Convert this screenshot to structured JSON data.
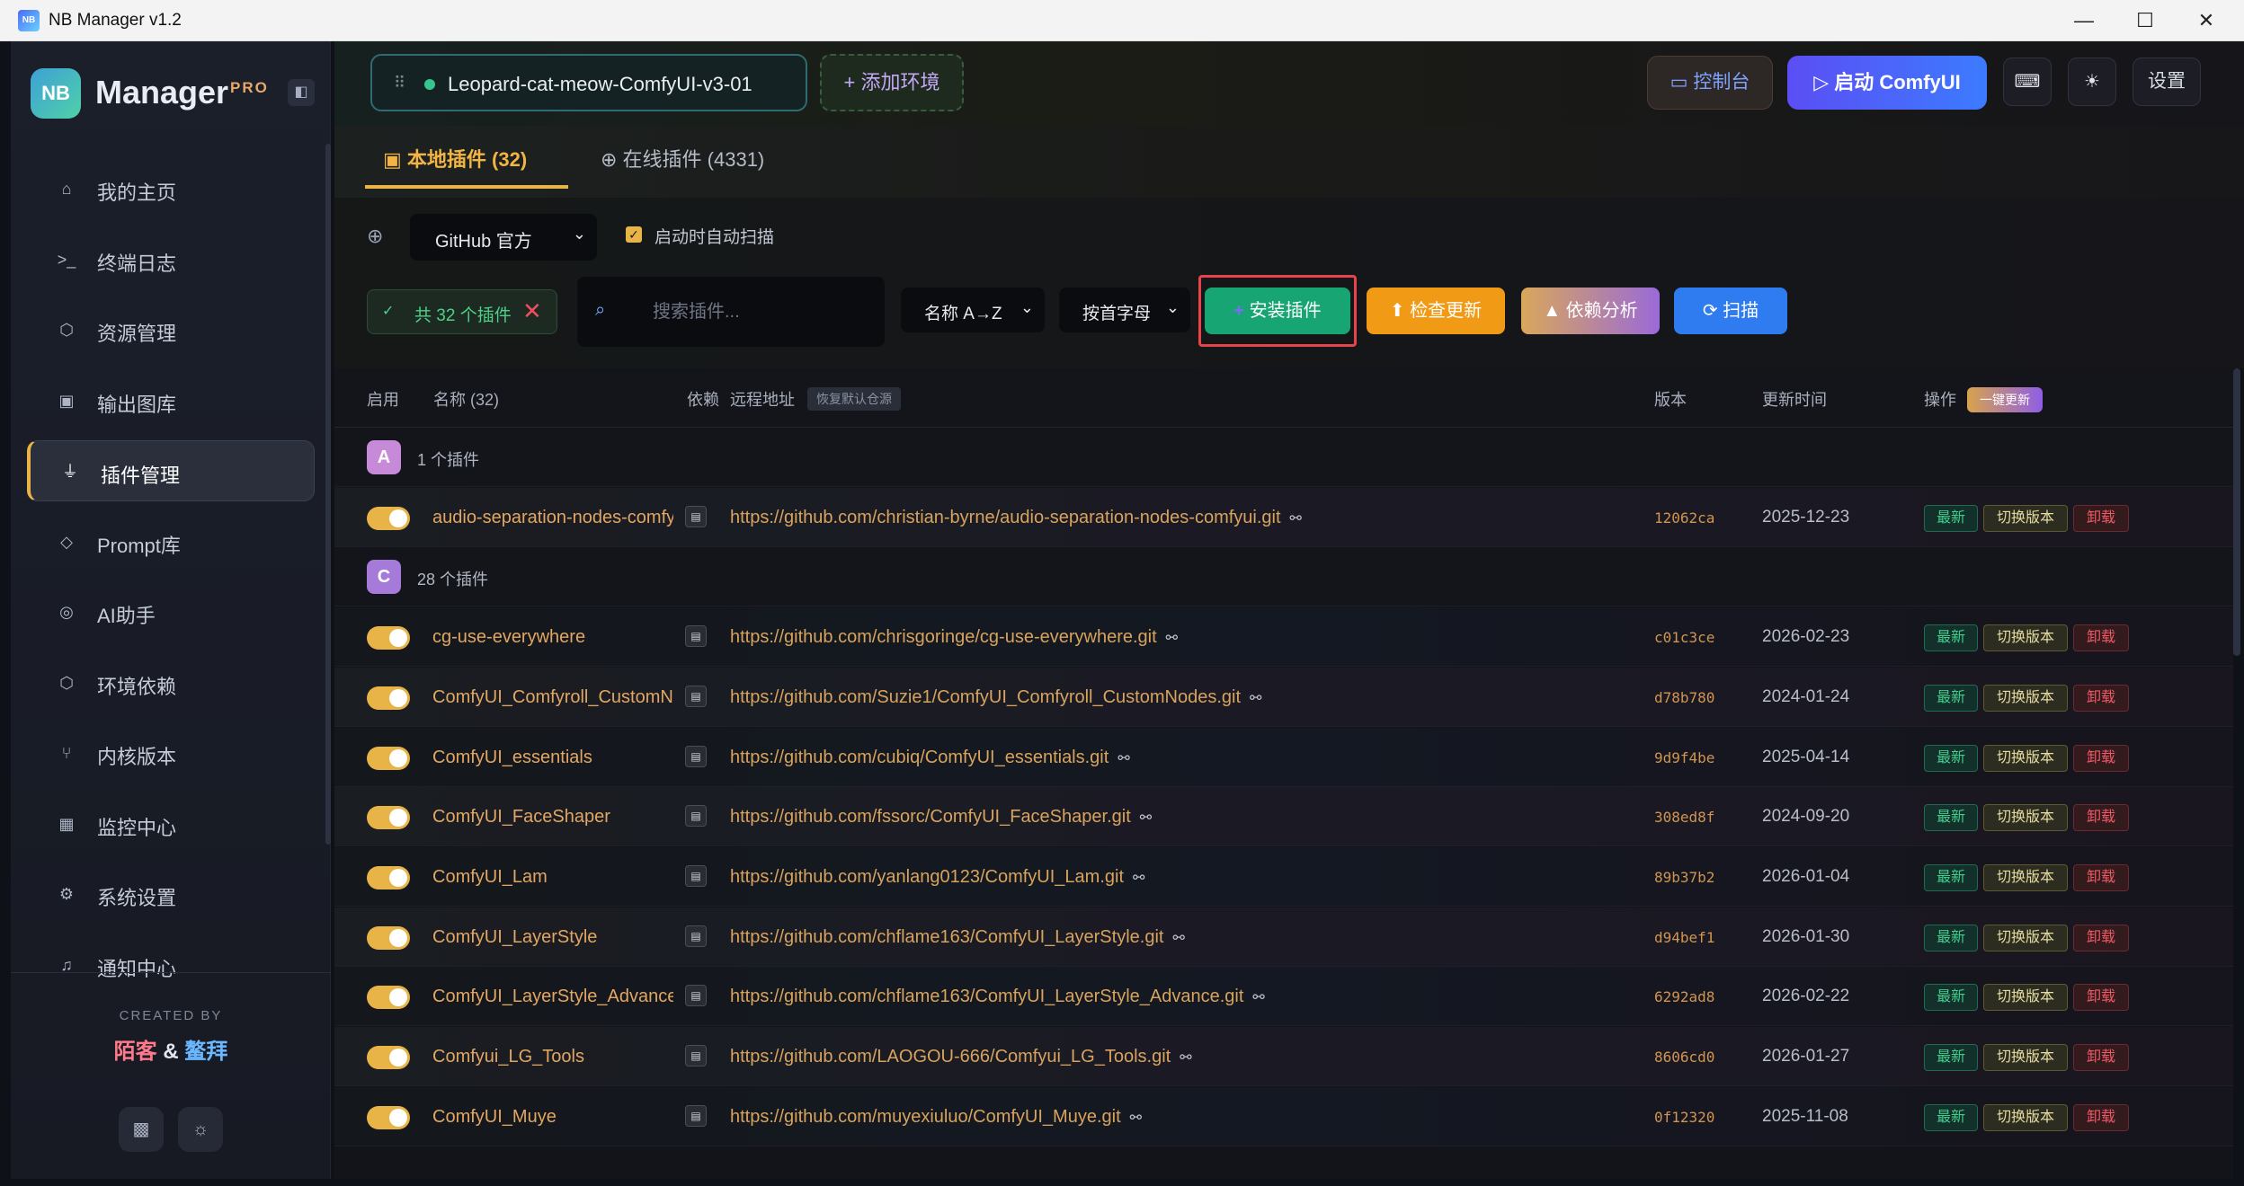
{
  "window": {
    "title": "NB Manager v1.2",
    "app_icon": "NB",
    "controls": [
      "minimize-icon",
      "maximize-icon",
      "close-icon"
    ]
  },
  "sidebar": {
    "logo_badge": "NB",
    "logo_text": "Manager",
    "logo_pro": "PRO",
    "items": [
      {
        "label": "我的主页",
        "icon": "home-icon",
        "glyph": "⌂"
      },
      {
        "label": "终端日志",
        "icon": "terminal-icon",
        "glyph": ">_"
      },
      {
        "label": "资源管理",
        "icon": "cube-icon",
        "glyph": "⬡"
      },
      {
        "label": "输出图库",
        "icon": "image-icon",
        "glyph": "▣"
      },
      {
        "label": "插件管理",
        "icon": "plug-icon",
        "glyph": "⏚",
        "active": true
      },
      {
        "label": "Prompt库",
        "icon": "tag-icon",
        "glyph": "◇"
      },
      {
        "label": "AI助手",
        "icon": "robot-icon",
        "glyph": "◎"
      },
      {
        "label": "环境依赖",
        "icon": "package-icon",
        "glyph": "⬡"
      },
      {
        "label": "内核版本",
        "icon": "branch-icon",
        "glyph": "⑂"
      },
      {
        "label": "监控中心",
        "icon": "cpu-icon",
        "glyph": "▦"
      },
      {
        "label": "系统设置",
        "icon": "gear-icon",
        "glyph": "⚙"
      },
      {
        "label": "通知中心",
        "icon": "bell-icon",
        "glyph": "♫"
      }
    ],
    "created_by": "CREATED BY",
    "author1": "陌客",
    "amp": "&",
    "author2": "鳌拜",
    "footer_buttons": [
      "qr-icon",
      "sun-icon"
    ]
  },
  "topbar": {
    "env_name": "Leopard-cat-meow-ComfyUI-v3-01",
    "add_env": "+ 添加环境",
    "console": "控制台",
    "start": "▷ 启动 ComfyUI",
    "settings": "设置"
  },
  "tabs": [
    {
      "label": "本地插件 (32)",
      "icon": "box-icon",
      "active": true
    },
    {
      "label": "在线插件 (4331)",
      "icon": "globe-icon",
      "active": false
    }
  ],
  "controls": {
    "source": "GitHub 官方",
    "auto_scan_label": "启动时自动扫描",
    "auto_scan_checked": true,
    "count_badge": "共 32 个插件",
    "search_placeholder": "搜索插件...",
    "sort_name": "名称 A→Z",
    "sort_group": "按首字母",
    "install": "安装插件",
    "check_updates": "检查更新",
    "deps_analysis": "依赖分析",
    "scan": "扫描"
  },
  "table": {
    "headers": {
      "enabled": "启用",
      "name": "名称 (32)",
      "deps": "依赖",
      "remote": "远程地址",
      "restore": "恢复默认仓源",
      "version": "版本",
      "updated": "更新时间",
      "actions": "操作",
      "update_all": "一键更新"
    },
    "action_labels": {
      "latest": "最新",
      "switch": "切换版本",
      "uninstall": "卸载"
    },
    "groups": [
      {
        "letter": "A",
        "count": "1 个插件",
        "color": "#c68ad8"
      },
      {
        "letter": "C",
        "count": "28 个插件",
        "color": "#a57ad8"
      }
    ],
    "rows": [
      {
        "name": "audio-separation-nodes-comfyui",
        "url": "https://github.com/christian-byrne/audio-separation-nodes-comfyui.git",
        "version": "12062ca",
        "date": "2025-12-23",
        "group": "A"
      },
      {
        "name": "cg-use-everywhere",
        "url": "https://github.com/chrisgoringe/cg-use-everywhere.git",
        "version": "c01c3ce",
        "date": "2026-02-23",
        "group": "C"
      },
      {
        "name": "ComfyUI_Comfyroll_CustomNodes",
        "url": "https://github.com/Suzie1/ComfyUI_Comfyroll_CustomNodes.git",
        "version": "d78b780",
        "date": "2024-01-24",
        "group": "C"
      },
      {
        "name": "ComfyUI_essentials",
        "url": "https://github.com/cubiq/ComfyUI_essentials.git",
        "version": "9d9f4be",
        "date": "2025-04-14",
        "group": "C"
      },
      {
        "name": "ComfyUI_FaceShaper",
        "url": "https://github.com/fssorc/ComfyUI_FaceShaper.git",
        "version": "308ed8f",
        "date": "2024-09-20",
        "group": "C"
      },
      {
        "name": "ComfyUI_Lam",
        "url": "https://github.com/yanlang0123/ComfyUI_Lam.git",
        "version": "89b37b2",
        "date": "2026-01-04",
        "group": "C"
      },
      {
        "name": "ComfyUI_LayerStyle",
        "url": "https://github.com/chflame163/ComfyUI_LayerStyle.git",
        "version": "d94bef1",
        "date": "2026-01-30",
        "group": "C"
      },
      {
        "name": "ComfyUI_LayerStyle_Advance",
        "url": "https://github.com/chflame163/ComfyUI_LayerStyle_Advance.git",
        "version": "6292ad8",
        "date": "2026-02-22",
        "group": "C"
      },
      {
        "name": "Comfyui_LG_Tools",
        "url": "https://github.com/LAOGOU-666/Comfyui_LG_Tools.git",
        "version": "8606cd0",
        "date": "2026-01-27",
        "group": "C"
      },
      {
        "name": "ComfyUI_Muye",
        "url": "https://github.com/muyexiuluo/ComfyUI_Muye.git",
        "version": "0f12320",
        "date": "2025-11-08",
        "group": "C"
      }
    ]
  },
  "colors": {
    "accent": "#e8b448",
    "install": "#18a574",
    "check": "#f19a15",
    "scan": "#2f7bf0",
    "start": "#5b4ef4"
  }
}
